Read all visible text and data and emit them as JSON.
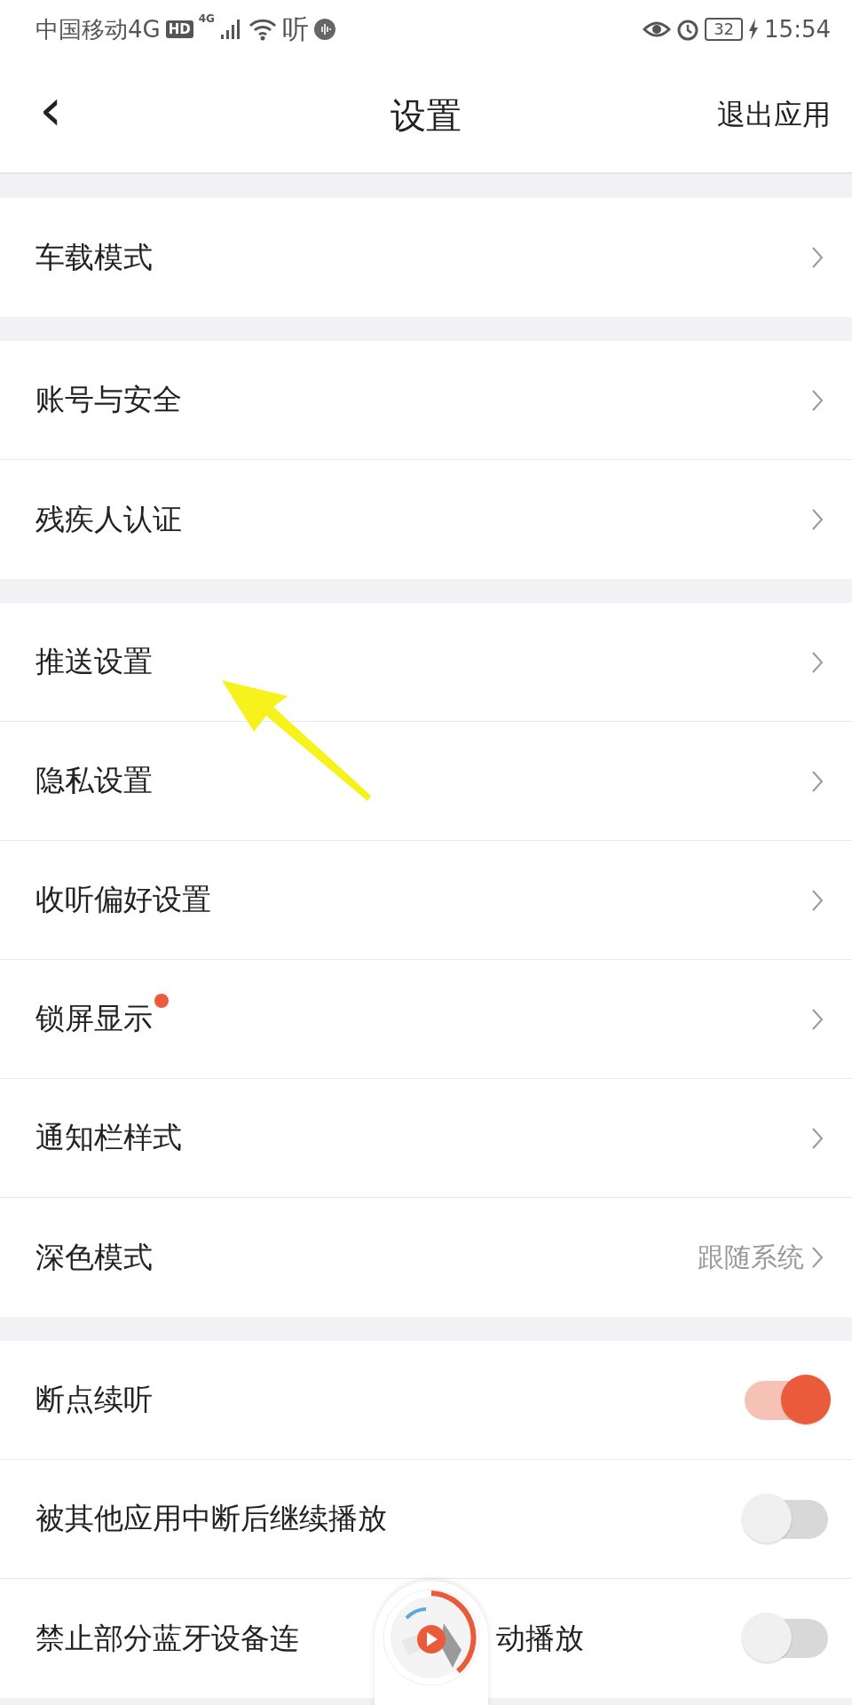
{
  "status_bar": {
    "carrier": "中国移动4G",
    "hd": "HD",
    "network": "4G",
    "app_glyph": "听",
    "battery": "32",
    "time": "15:54"
  },
  "header": {
    "back": "‹",
    "title": "设置",
    "action": "退出应用"
  },
  "groups": [
    {
      "rows": [
        {
          "kind": "link",
          "label": "车载模式"
        }
      ]
    },
    {
      "rows": [
        {
          "kind": "link",
          "label": "账号与安全"
        },
        {
          "kind": "link",
          "label": "残疾人认证"
        }
      ]
    },
    {
      "rows": [
        {
          "kind": "link",
          "label": "推送设置"
        },
        {
          "kind": "link",
          "label": "隐私设置"
        },
        {
          "kind": "link",
          "label": "收听偏好设置"
        },
        {
          "kind": "link",
          "label": "锁屏显示",
          "badge": true
        },
        {
          "kind": "link",
          "label": "通知栏样式"
        },
        {
          "kind": "link",
          "label": "深色模式",
          "value": "跟随系统"
        }
      ]
    },
    {
      "rows": [
        {
          "kind": "toggle",
          "label": "断点续听",
          "on": true
        },
        {
          "kind": "toggle",
          "label": "被其他应用中断后继续播放",
          "on": false
        },
        {
          "kind": "toggle",
          "label": "禁止部分蓝牙设备连",
          "label_end": "动播放",
          "on": false
        }
      ]
    }
  ]
}
